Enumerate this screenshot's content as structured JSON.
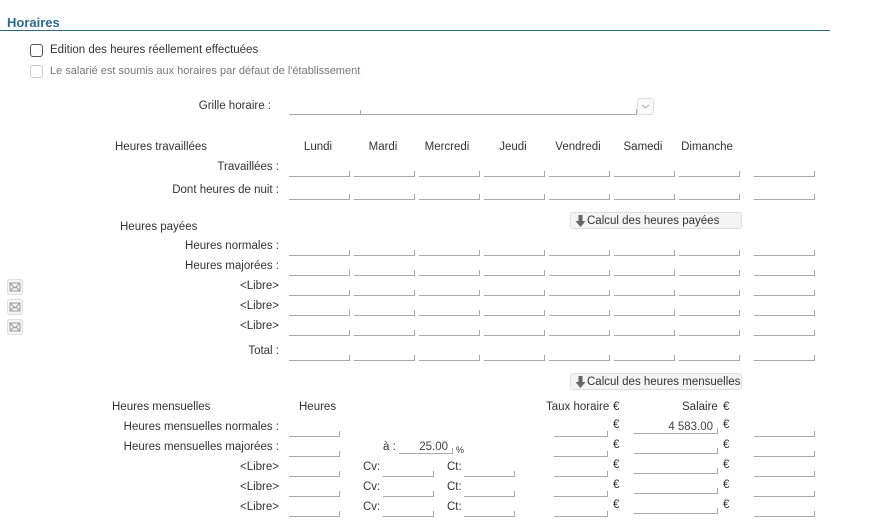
{
  "section_title": "Horaires",
  "checkboxes": {
    "edition": "Edition des heures réellement effectuées",
    "defaut": "Le salarié est soumis aux horaires par défaut de l'établissement"
  },
  "grille": {
    "label": "Grille horaire :",
    "value": ""
  },
  "travaillees": {
    "header": "Heures travaillées",
    "days": [
      "Lundi",
      "Mardi",
      "Mercredi",
      "Jeudi",
      "Vendredi",
      "Samedi",
      "Dimanche"
    ],
    "rows": [
      "Travaillées :",
      "Dont heures de nuit :"
    ]
  },
  "payees": {
    "header": "Heures payées",
    "button": "Calcul des heures payées",
    "rows": [
      "Heures normales :",
      "Heures majorées :",
      "<Libre>",
      "<Libre>",
      "<Libre>",
      "Total :"
    ]
  },
  "mensuelles": {
    "button": "Calcul des heures mensuelles",
    "header": "Heures mensuelles",
    "col_heures": "Heures",
    "col_taux": "Taux horaire",
    "col_salaire": "Salaire",
    "currency": "€",
    "a_label": "à :",
    "a_value": "25.00",
    "percent": "%",
    "cv_label": "Cv:",
    "ct_label": "Ct:",
    "rows": [
      {
        "label": "Heures mensuelles normales :",
        "salaire": "4 583.00"
      },
      {
        "label": "Heures mensuelles majorées :",
        "salaire": ""
      },
      {
        "label": "<Libre>",
        "salaire": ""
      },
      {
        "label": "<Libre>",
        "salaire": ""
      },
      {
        "label": "<Libre>",
        "salaire": ""
      }
    ]
  }
}
